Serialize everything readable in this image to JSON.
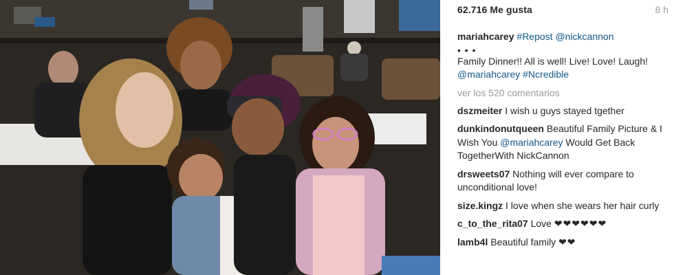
{
  "post": {
    "likes": "62.716 Me gusta",
    "time": "8 h",
    "caption": {
      "user": "mariahcarey",
      "tag_repost": "#Repost",
      "tag_user": "@nickcannon",
      "dots": "• • •",
      "text": "Family Dinner!! All is well! Live! Love! Laugh!",
      "tag_mention": "@mariahcarey",
      "tag_hash": "#Ncredible"
    },
    "view_all": "ver los 520 comentarios",
    "comments": [
      {
        "user": "dszmeiter",
        "text": "I wish u guys stayed tgether"
      },
      {
        "user": "dunkindonutqueen",
        "text": "Beautiful Family Picture & I Wish You",
        "mention": "@mariahcarey",
        "text2": "Would Get Back TogetherWith NickCannon"
      },
      {
        "user": "drsweets07",
        "text": "Nothing will ever compare to unconditional love!"
      },
      {
        "user": "size.kingz",
        "text": "I love when she wears her hair curly"
      },
      {
        "user": "c_to_the_rita07",
        "text": "Love",
        "hearts": "❤❤❤❤❤❤"
      },
      {
        "user": "lamb4l",
        "text": "Beautiful family",
        "hearts": "❤❤"
      }
    ]
  },
  "colors": {
    "link": "#125688",
    "muted": "#999999",
    "text": "#262626"
  }
}
